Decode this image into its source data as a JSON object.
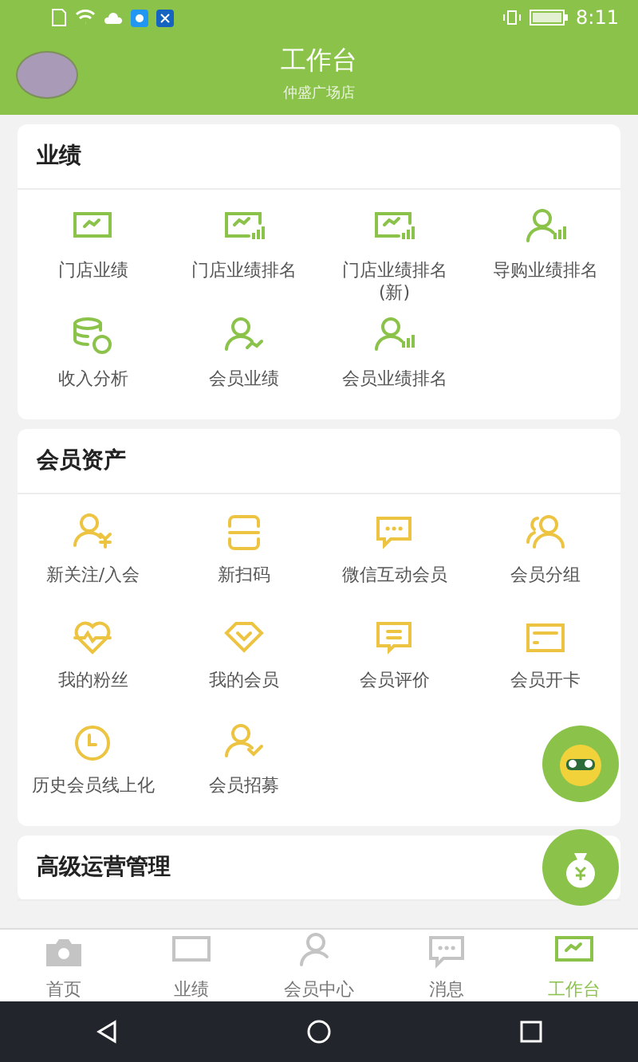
{
  "status_bar": {
    "time": "8:11"
  },
  "header": {
    "title": "工作台",
    "subtitle": "仲盛广场店"
  },
  "sections": [
    {
      "title": "业绩",
      "color": "#8bc34a",
      "items": [
        {
          "label": "门店业绩",
          "kind": "monitor-chart"
        },
        {
          "label": "门店业绩排名",
          "kind": "monitor-bars"
        },
        {
          "label": "门店业绩排名(新)",
          "kind": "monitor-bars"
        },
        {
          "label": "导购业绩排名",
          "kind": "person-bars"
        },
        {
          "label": "收入分析",
          "kind": "coins"
        },
        {
          "label": "会员业绩",
          "kind": "person-chart"
        },
        {
          "label": "会员业绩排名",
          "kind": "person-bars"
        }
      ]
    },
    {
      "title": "会员资产",
      "color": "#ecc441",
      "items": [
        {
          "label": "新关注/入会",
          "kind": "person-yen"
        },
        {
          "label": "新扫码",
          "kind": "scan"
        },
        {
          "label": "微信互动会员",
          "kind": "chat"
        },
        {
          "label": "会员分组",
          "kind": "people"
        },
        {
          "label": "我的粉丝",
          "kind": "heart-pulse"
        },
        {
          "label": "我的会员",
          "kind": "diamond"
        },
        {
          "label": "会员评价",
          "kind": "comment"
        },
        {
          "label": "会员开卡",
          "kind": "card"
        },
        {
          "label": "历史会员线上化",
          "kind": "clock"
        },
        {
          "label": "会员招募",
          "kind": "person-check"
        }
      ]
    },
    {
      "title": "高级运营管理"
    }
  ],
  "tabs": [
    {
      "label": "首页",
      "kind": "camera",
      "selected": false
    },
    {
      "label": "业绩",
      "kind": "monitor",
      "selected": false
    },
    {
      "label": "会员中心",
      "kind": "person",
      "selected": false
    },
    {
      "label": "消息",
      "kind": "chat",
      "selected": false
    },
    {
      "label": "工作台",
      "kind": "monitor-chart",
      "selected": true
    }
  ]
}
